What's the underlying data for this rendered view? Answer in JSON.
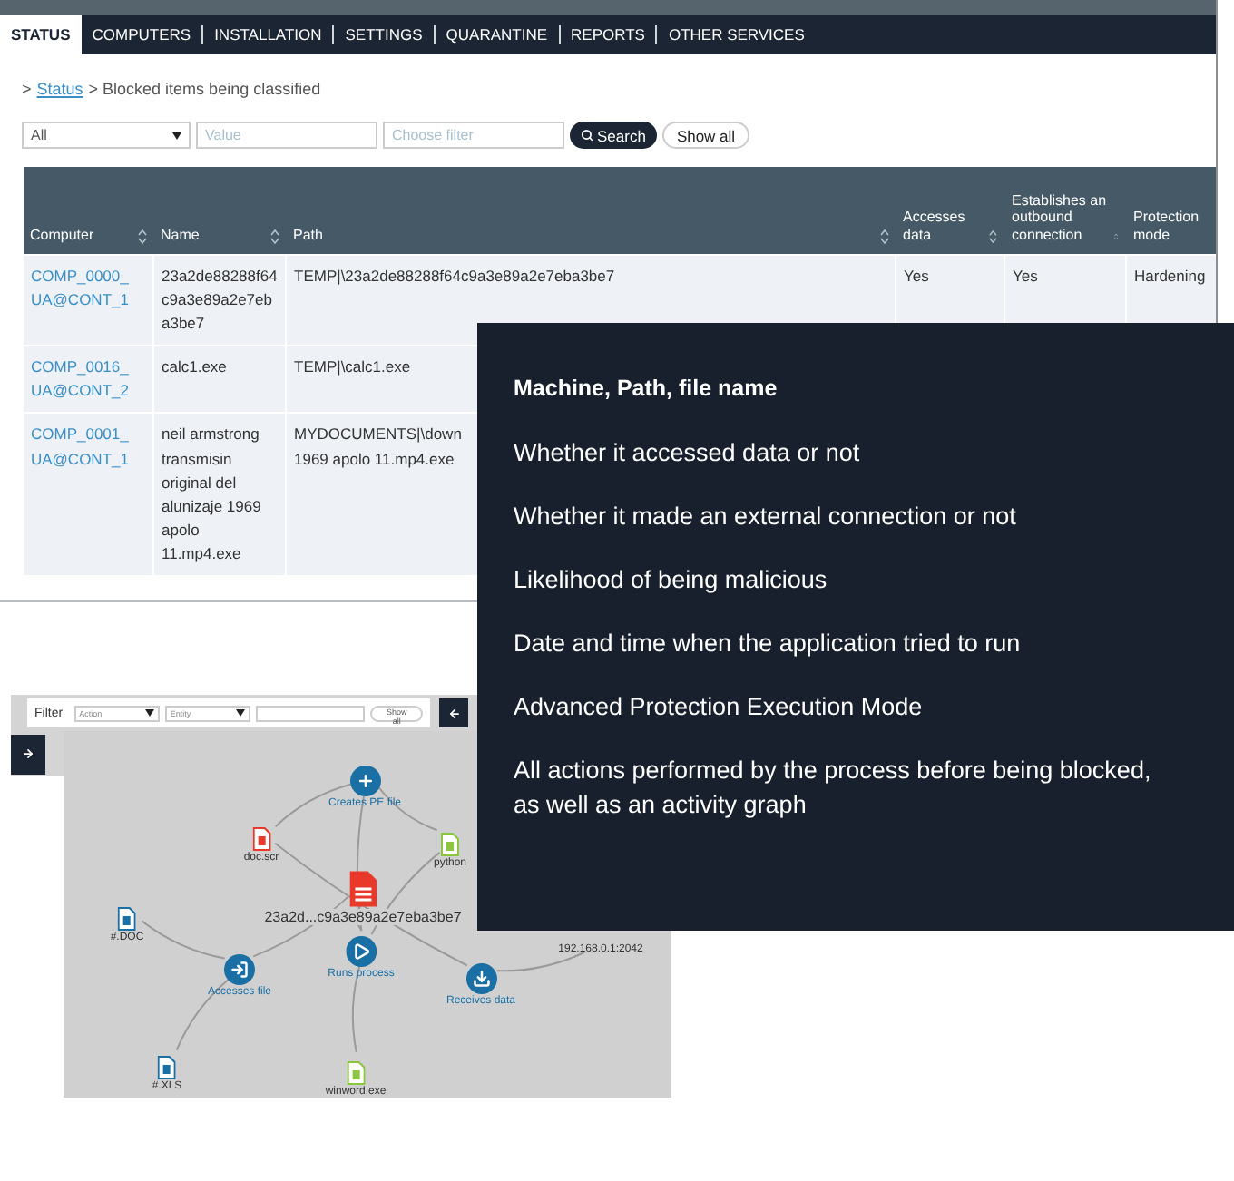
{
  "nav_tabs": [
    {
      "label": "STATUS",
      "selected": true
    },
    {
      "label": "COMPUTERS",
      "selected": false
    },
    {
      "label": "INSTALLATION",
      "selected": false
    },
    {
      "label": "SETTINGS",
      "selected": false
    },
    {
      "label": "QUARANTINE",
      "selected": false
    },
    {
      "label": "REPORTS",
      "selected": false
    },
    {
      "label": "OTHER SERVICES",
      "selected": false
    }
  ],
  "breadcrumb": {
    "prefix": ">",
    "link": "Status",
    "current": "> Blocked items being classified"
  },
  "filters": {
    "select": "All",
    "value_placeholder": "Value",
    "filter_placeholder": "Choose filter",
    "search_button": "Search",
    "show_all_button": "Show all"
  },
  "table": {
    "columns": [
      "Computer",
      "Name",
      "Path",
      "Accesses data",
      "Establishes an outbound connection",
      "Protection mode"
    ],
    "rows": [
      {
        "computer": "COMP_0000_UA@CONT_1",
        "name": "23a2de88288f64c9a3e89a2e7eba3be7",
        "path": [
          "TEMP|\\23a2de88288f64c9a3e89a2e7eba3be7"
        ],
        "accesses_data": "Yes",
        "outbound": "Yes",
        "protection_mode": "Hardening"
      },
      {
        "computer": "COMP_0016_UA@CONT_2",
        "name": "calc1.exe",
        "path": [
          "TEMP|\\calc1.exe"
        ]
      },
      {
        "computer": "COMP_0001_UA@CONT_1",
        "name": "neil armstrong transmisin original del alunizaje 1969 apolo 11.mp4.exe",
        "path": [
          "MYDOCUMENTS|\\down",
          "1969 apolo 11.mp4.exe"
        ]
      }
    ]
  },
  "graph": {
    "toolbar": {
      "label": "Filter",
      "action_select": "Action",
      "entity_select": "Entity",
      "show_all_button": "Show all"
    },
    "nodes": [
      {
        "kind": "create",
        "label": "Creates PE file"
      },
      {
        "kind": "file",
        "label": "doc.scr",
        "color": "#e8392b"
      },
      {
        "kind": "file",
        "label": "python",
        "color": "#8cc63e"
      },
      {
        "kind": "main",
        "label": "23a2d...c9a3e89a2e7eba3be7",
        "color": "#e8392b"
      },
      {
        "kind": "file",
        "label": "#.DOC",
        "color": "#1a6fa5"
      },
      {
        "kind": "access",
        "label": "Accesses file"
      },
      {
        "kind": "run",
        "label": "Runs process"
      },
      {
        "kind": "receive",
        "label": "Receives data"
      },
      {
        "kind": "address",
        "label": "192.168.0.1:2042"
      },
      {
        "kind": "file",
        "label": "#.XLS",
        "color": "#1a6fa5"
      },
      {
        "kind": "file",
        "label": "winword.exe",
        "color": "#8cc63e"
      }
    ]
  },
  "overlay": {
    "items": [
      "Machine, Path, file name",
      "Whether it accessed data or not",
      "Whether it made an external connection or not",
      "Likelihood of being malicious",
      "Date and time when the application tried to run",
      "Advanced Protection Execution Mode",
      "All actions performed by the process before being blocked, as well as an activity graph"
    ]
  }
}
